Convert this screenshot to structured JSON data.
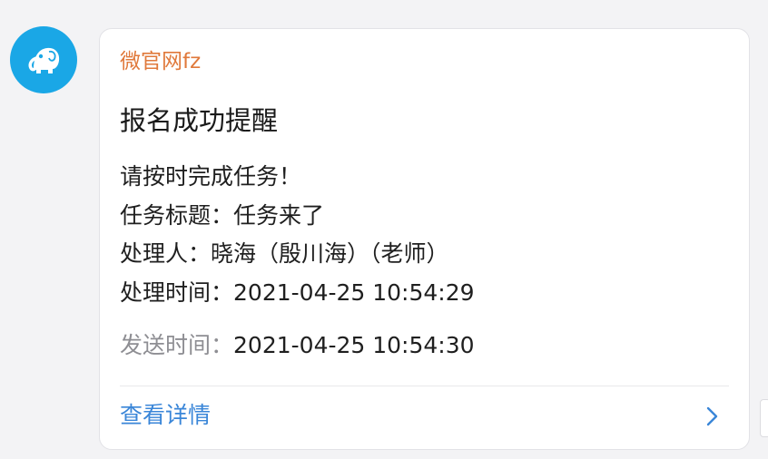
{
  "avatar": {
    "icon": "elephant-icon",
    "bg_color": "#1aa7e6"
  },
  "card": {
    "sender": "微官网fz",
    "title": "报名成功提醒",
    "message": "请按时完成任务！",
    "fields": [
      {
        "label": "任务标题：",
        "value": "任务来了"
      },
      {
        "label": "处理人：",
        "value": "晓海（殷川海）（老师）"
      },
      {
        "label": "处理时间：",
        "value": "2021-04-25 10:54:29"
      }
    ],
    "send_time": {
      "label": "发送时间：",
      "value": "2021-04-25 10:54:30"
    },
    "detail_link": "查看详情",
    "detail_icon": "chevron-right-icon"
  },
  "colors": {
    "sender": "#e0793b",
    "link": "#3a86d8",
    "muted": "#8e8e93"
  }
}
